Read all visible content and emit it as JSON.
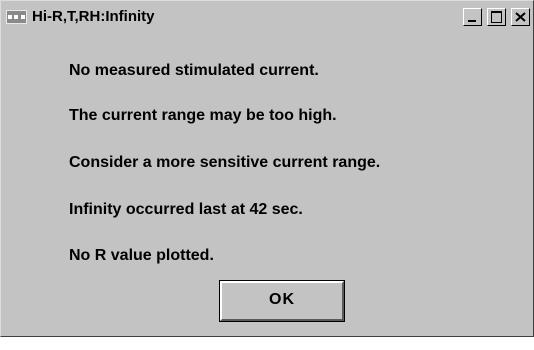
{
  "window": {
    "title": "Hi-R,T,RH:Infinity",
    "icon": "app-window-icon",
    "controls": [
      "minimize-icon",
      "maximize-icon",
      "close-icon"
    ]
  },
  "messages": [
    "No measured stimulated current.",
    "The current range may be too high.",
    "Consider a more sensitive current range.",
    "Infinity occurred last at 42 sec.",
    "No R value plotted."
  ],
  "ok_button": {
    "label": "OK"
  },
  "colors": {
    "face": "#c3c3c3",
    "text": "#000000"
  }
}
